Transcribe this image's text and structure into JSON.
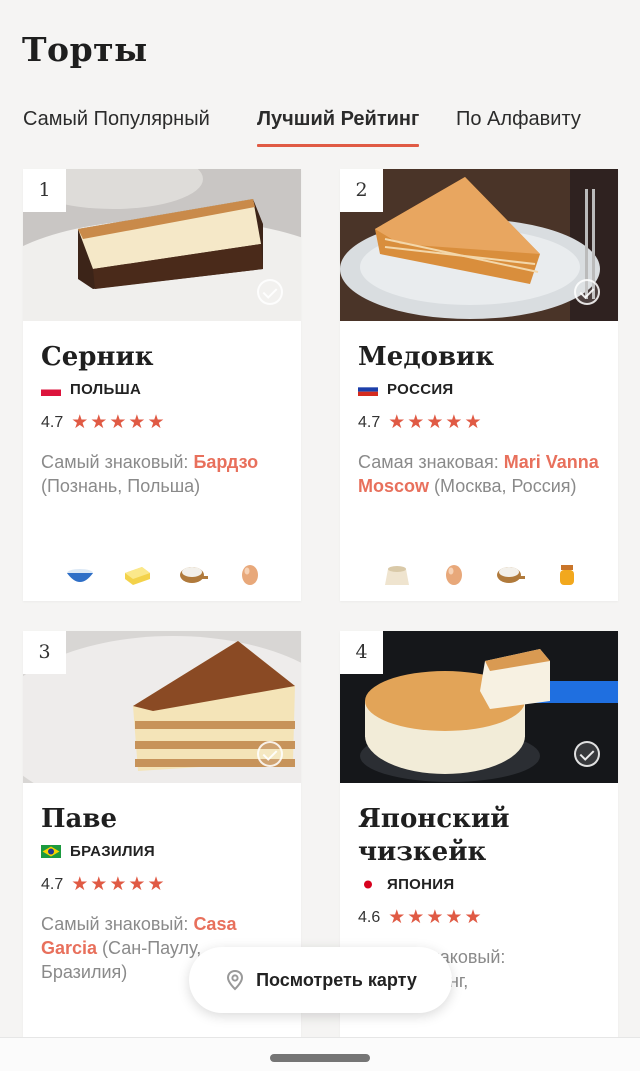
{
  "header": {
    "title": "Торты"
  },
  "tabs": [
    {
      "label": "Самый Популярный",
      "active": false
    },
    {
      "label": "Лучший Рейтинг",
      "active": true
    },
    {
      "label": "По Алфавиту",
      "active": false
    }
  ],
  "cards": [
    {
      "rank": "1",
      "name": "Серник",
      "country": "ПОЛЬША",
      "rating": "4.7",
      "stars": 5,
      "desc_prefix": "Самый знаковый: ",
      "place": "Бардзо",
      "desc_suffix": " (Познань, Польша)",
      "ingredients": [
        "bowl-icon",
        "butter-icon",
        "flour-icon",
        "egg-icon"
      ]
    },
    {
      "rank": "2",
      "name": "Медовик",
      "country": "РОССИЯ",
      "rating": "4.7",
      "stars": 5,
      "desc_prefix": "Самая знаковая: ",
      "place": "Mari Vanna Moscow",
      "desc_suffix": " (Москва, Россия)",
      "ingredients": [
        "flour-bag-icon",
        "egg-icon",
        "flour-icon",
        "honey-icon"
      ]
    },
    {
      "rank": "3",
      "name": "Паве",
      "country": "БРАЗИЛИЯ",
      "rating": "4.7",
      "stars": 5,
      "desc_prefix": "Самый знаковый: ",
      "place": "Casa Garcia",
      "desc_suffix": " (Сан-Паулу, Бразилия)"
    },
    {
      "rank": "4",
      "name": "Японский чизкейк",
      "country": "ЯПОНИЯ",
      "rating": "4.6",
      "stars": 5,
      "desc_prefix": "Самый знаковый: ",
      "place": "",
      "desc_suffix": " (Дарджилинг,"
    }
  ],
  "map_button": {
    "label": "Посмотреть карту",
    "icon": "map-pin-icon"
  },
  "colors": {
    "accent": "#e05a44",
    "place": "#e8705c"
  }
}
